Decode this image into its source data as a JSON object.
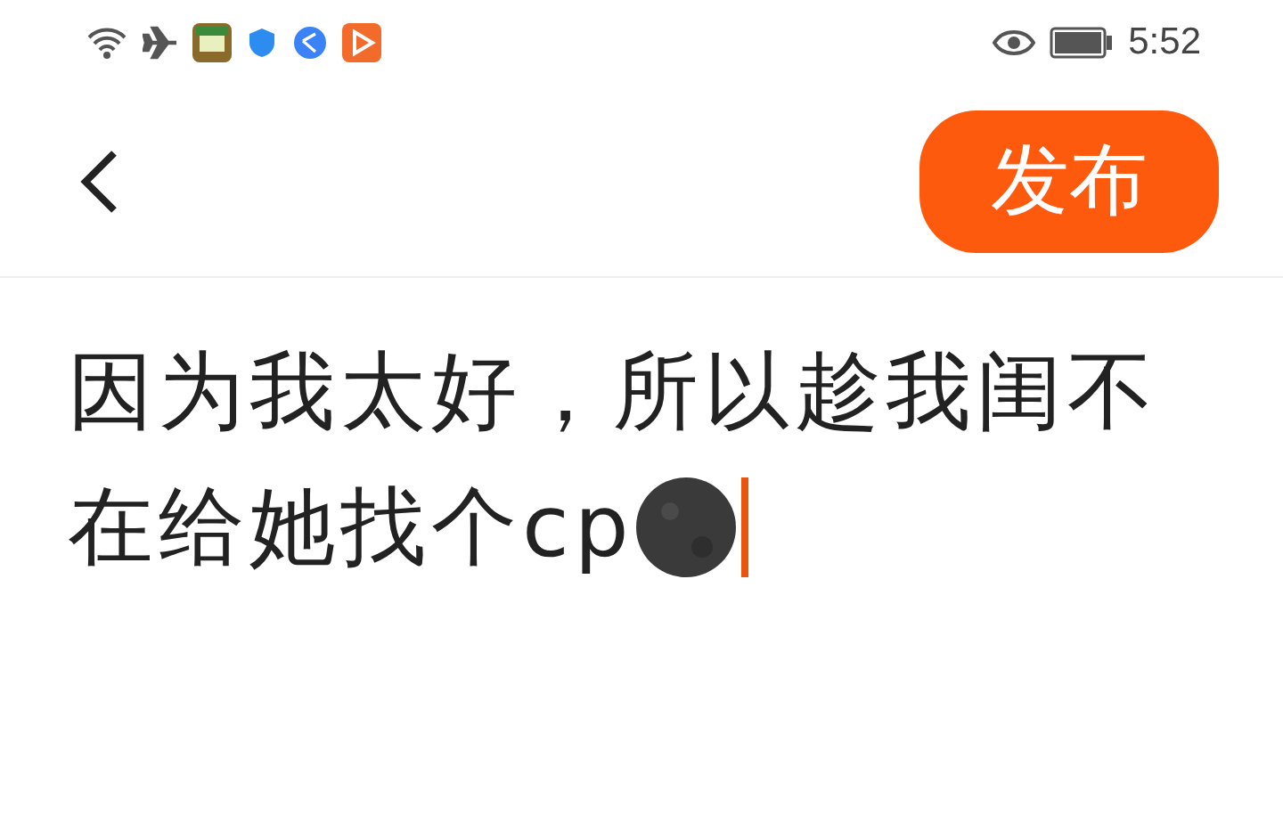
{
  "status_bar": {
    "time": "5:52"
  },
  "header": {
    "publish_button": "发布"
  },
  "editor": {
    "lines": [
      "因为我太好，所以趁我闺不",
      "在给她找个cp"
    ]
  }
}
